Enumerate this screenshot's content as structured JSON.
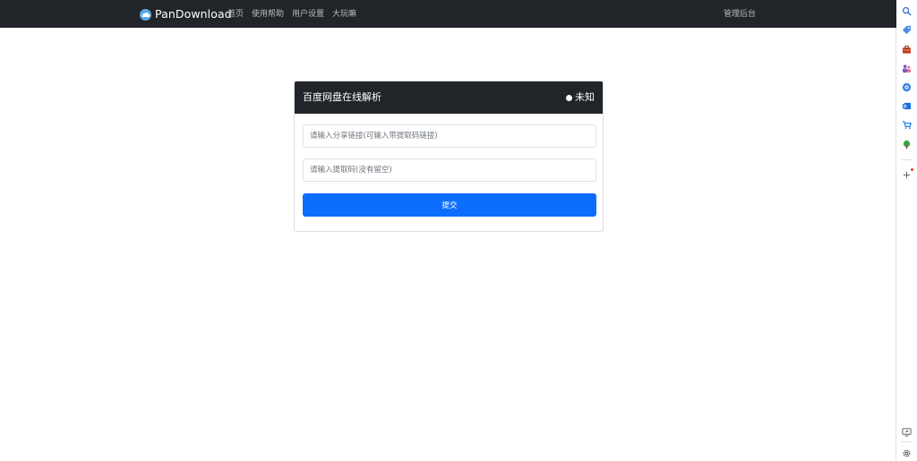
{
  "navbar": {
    "brand": "PanDownload",
    "links": [
      {
        "label": "首页"
      },
      {
        "label": "使用帮助"
      },
      {
        "label": "用户设置"
      },
      {
        "label": "大玩嘛"
      }
    ],
    "admin_label": "管理后台"
  },
  "card": {
    "title": "百度网盘在线解析",
    "status": "未知",
    "share_link_placeholder": "请输入分享链接(可输入带提取码链接)",
    "share_link_value": "",
    "code_placeholder": "请输入提取码(没有留空)",
    "code_value": "",
    "submit_label": "提交"
  },
  "sidebar": {
    "icons": [
      "search-icon",
      "tag-icon",
      "briefcase-icon",
      "people-icon",
      "copilot-icon",
      "outlook-icon",
      "cart-icon",
      "tree-icon",
      "add-icon",
      "screen-share-icon",
      "settings-icon"
    ]
  },
  "colors": {
    "navbar_bg": "#212529",
    "primary_button": "#0d6efd",
    "nav_link": "#b8bbbe"
  }
}
